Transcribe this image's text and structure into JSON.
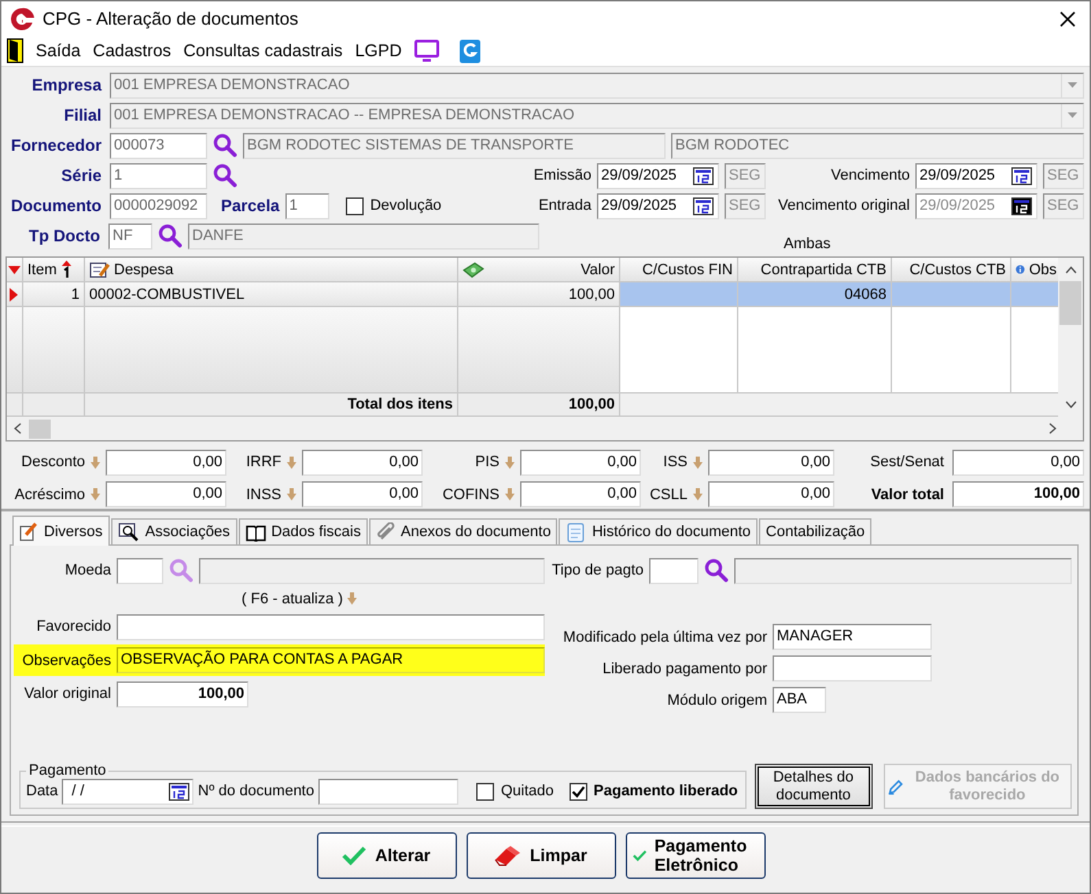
{
  "window": {
    "title": "CPG - Alteração de documentos"
  },
  "menu": [
    {
      "label": "Saída"
    },
    {
      "label": "Cadastros"
    },
    {
      "label": "Consultas cadastrais"
    },
    {
      "label": "LGPD"
    }
  ],
  "header": {
    "empresa": {
      "label": "Empresa",
      "value": "001 EMPRESA DEMONSTRACAO"
    },
    "filial": {
      "label": "Filial",
      "value": "001 EMPRESA DEMONSTRACAO -- EMPRESA DEMONSTRACAO"
    },
    "fornecedor": {
      "label": "Fornecedor",
      "code": "000073",
      "name": "BGM RODOTEC SISTEMAS DE TRANSPORTE",
      "fantasy": "BGM RODOTEC"
    },
    "serie": {
      "label": "Série",
      "value": "1"
    },
    "documento": {
      "label": "Documento",
      "value": "0000029092"
    },
    "parcela": {
      "label": "Parcela",
      "value": "1"
    },
    "devolucao": {
      "label": "Devolução",
      "checked": false
    },
    "tp_docto": {
      "label": "Tp Docto",
      "code": "NF",
      "description": "DANFE"
    },
    "dates": [
      {
        "label": "Emissão",
        "value": "29/09/2025",
        "weekday": "SEG",
        "disabled": false
      },
      {
        "label": "Vencimento",
        "value": "29/09/2025",
        "weekday": "SEG",
        "disabled": false
      },
      {
        "label": "Entrada",
        "value": "29/09/2025",
        "weekday": "SEG",
        "disabled": false
      },
      {
        "label": "Vencimento original",
        "value": "29/09/2025",
        "weekday": "SEG",
        "disabled": true
      }
    ],
    "ambas": "Ambas"
  },
  "grid": {
    "columns": [
      "Item",
      "Despesa",
      "Valor",
      "C/Custos FIN",
      "Contrapartida CTB",
      "C/Custos CTB",
      "Obs"
    ],
    "rows": [
      {
        "item": "1",
        "despesa": "00002-COMBUSTIVEL",
        "valor": "100,00",
        "contrapartida_ctb": "04068",
        "selected": true
      }
    ],
    "total": {
      "label": "Total dos itens",
      "value": "100,00"
    }
  },
  "taxes": [
    {
      "label": "Desconto",
      "value": "0,00",
      "kind": "adjust"
    },
    {
      "label": "IRRF",
      "value": "0,00",
      "kind": "adjust"
    },
    {
      "label": "PIS",
      "value": "0,00",
      "kind": "adjust"
    },
    {
      "label": "ISS",
      "value": "0,00",
      "kind": "adjust"
    },
    {
      "label": "Sest/Senat",
      "value": "0,00",
      "kind": "plain"
    },
    {
      "label": "Acréscimo",
      "value": "0,00",
      "kind": "adjust"
    },
    {
      "label": "INSS",
      "value": "0,00",
      "kind": "adjust"
    },
    {
      "label": "COFINS",
      "value": "0,00",
      "kind": "adjust"
    },
    {
      "label": "CSLL",
      "value": "0,00",
      "kind": "adjust"
    },
    {
      "label": "Valor total",
      "value": "100,00",
      "kind": "total"
    }
  ],
  "tabs": [
    {
      "label": "Diversos",
      "selected": true
    },
    {
      "label": "Associações",
      "selected": false
    },
    {
      "label": "Dados fiscais",
      "selected": false
    },
    {
      "label": "Anexos do documento",
      "selected": false
    },
    {
      "label": "Histórico do documento",
      "selected": false
    },
    {
      "label": "Contabilização",
      "selected": false
    }
  ],
  "diversos": {
    "moeda": {
      "label": "Moeda"
    },
    "tipo_pagto": {
      "label": "Tipo de pagto"
    },
    "f6_hint": "( F6 - atualiza )",
    "favorecido": {
      "label": "Favorecido"
    },
    "observacoes": {
      "label": "Observações",
      "value": "OBSERVAÇÃO PARA CONTAS A PAGAR",
      "highlighted": true
    },
    "valor_original": {
      "label": "Valor original",
      "value": "100,00"
    },
    "modificado": {
      "label": "Modificado pela última vez por",
      "value": "MANAGER"
    },
    "liberado": {
      "label": "Liberado pagamento por"
    },
    "modulo": {
      "label": "Módulo origem",
      "value": "ABA"
    }
  },
  "pagamento": {
    "title": "Pagamento",
    "data_label": "Data",
    "data_value": "/ /",
    "documento_label": "Nº do documento",
    "quitado": {
      "label": "Quitado",
      "checked": false
    },
    "liberado": {
      "label": "Pagamento liberado",
      "checked": true
    }
  },
  "side_buttons": [
    {
      "label": "Detalhes do documento",
      "disabled": false
    },
    {
      "label": "Dados bancários do favorecido",
      "disabled": true
    }
  ],
  "buttons": [
    {
      "label": "Alterar"
    },
    {
      "label": "Limpar"
    },
    {
      "label": "Pagamento Eletrônico"
    }
  ]
}
